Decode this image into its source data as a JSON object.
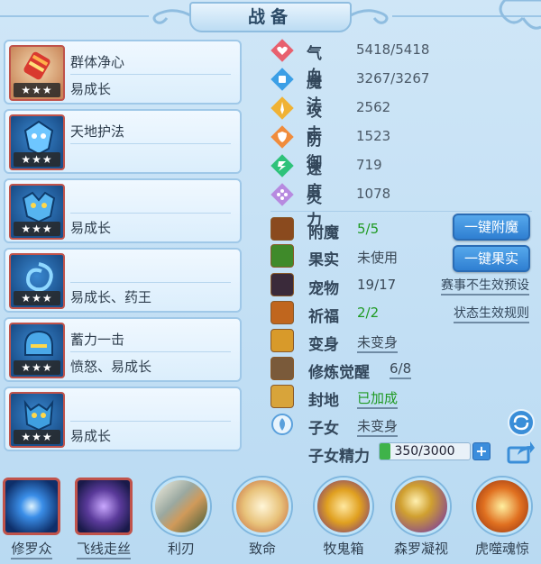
{
  "title": "战备",
  "cards": [
    {
      "line1": "群体净心",
      "line2": "易成长",
      "stars": "★★★"
    },
    {
      "line1": "天地护法",
      "line2": "",
      "stars": "★★★"
    },
    {
      "line1": "",
      "line2": "易成长",
      "stars": "★★★"
    },
    {
      "line1": "",
      "line2": "易成长、药王",
      "stars": "★★★"
    },
    {
      "line1": "蓄力一击",
      "line2": "愤怒、易成长",
      "stars": "★★★"
    },
    {
      "line1": "",
      "line2": "易成长",
      "stars": "★★★"
    }
  ],
  "stats": [
    {
      "label": "气血",
      "value": "5418/5418",
      "icon": "heart-icon",
      "color": "#e8606e"
    },
    {
      "label": "魔法",
      "value": "3267/3267",
      "icon": "magic-icon",
      "color": "#3c9fe6"
    },
    {
      "label": "攻击",
      "value": "2562",
      "icon": "sword-icon",
      "color": "#f0b234"
    },
    {
      "label": "防御",
      "value": "1523",
      "icon": "shield-icon",
      "color": "#f08c3c"
    },
    {
      "label": "速度",
      "value": "719",
      "icon": "lightning-icon",
      "color": "#2ec27a"
    },
    {
      "label": "灵力",
      "value": "1078",
      "icon": "spirit-icon",
      "color": "#b78ae0"
    }
  ],
  "info": {
    "enchant": {
      "label": "附魔",
      "value": "5/5"
    },
    "fruit": {
      "label": "果实",
      "value": "未使用"
    },
    "pet": {
      "label": "宠物",
      "value": "19/17",
      "link": "赛事不生效预设"
    },
    "bless": {
      "label": "祈福",
      "value": "2/2",
      "link": "状态生效规则"
    },
    "transform": {
      "label": "变身",
      "value": "未变身"
    },
    "cultivate": {
      "label": "修炼觉醒",
      "value": "6/8"
    },
    "seal": {
      "label": "封地",
      "value": "已加成"
    },
    "child": {
      "label": "子女",
      "value": "未变身"
    },
    "child_energy": {
      "label": "子女精力",
      "value": "350/3000",
      "fraction": 0.117
    }
  },
  "buttons": {
    "enchant": "一键附魔",
    "fruit": "一键果实"
  },
  "skills": [
    {
      "name": "修罗众",
      "style": "square",
      "color": "#2a4f9a"
    },
    {
      "name": "飞线走丝",
      "style": "square",
      "color": "#5a3a9a"
    },
    {
      "name": "利刃",
      "style": "orb",
      "color": "#9aa8a0"
    },
    {
      "name": "致命",
      "style": "orb",
      "color": "#e8c27a"
    },
    {
      "name": "牧鬼箱",
      "style": "orb",
      "color": "#e0a020"
    },
    {
      "name": "森罗凝视",
      "style": "orb",
      "color": "#d0a030"
    },
    {
      "name": "虎噬魂惊",
      "style": "orb",
      "color": "#e07020"
    }
  ]
}
